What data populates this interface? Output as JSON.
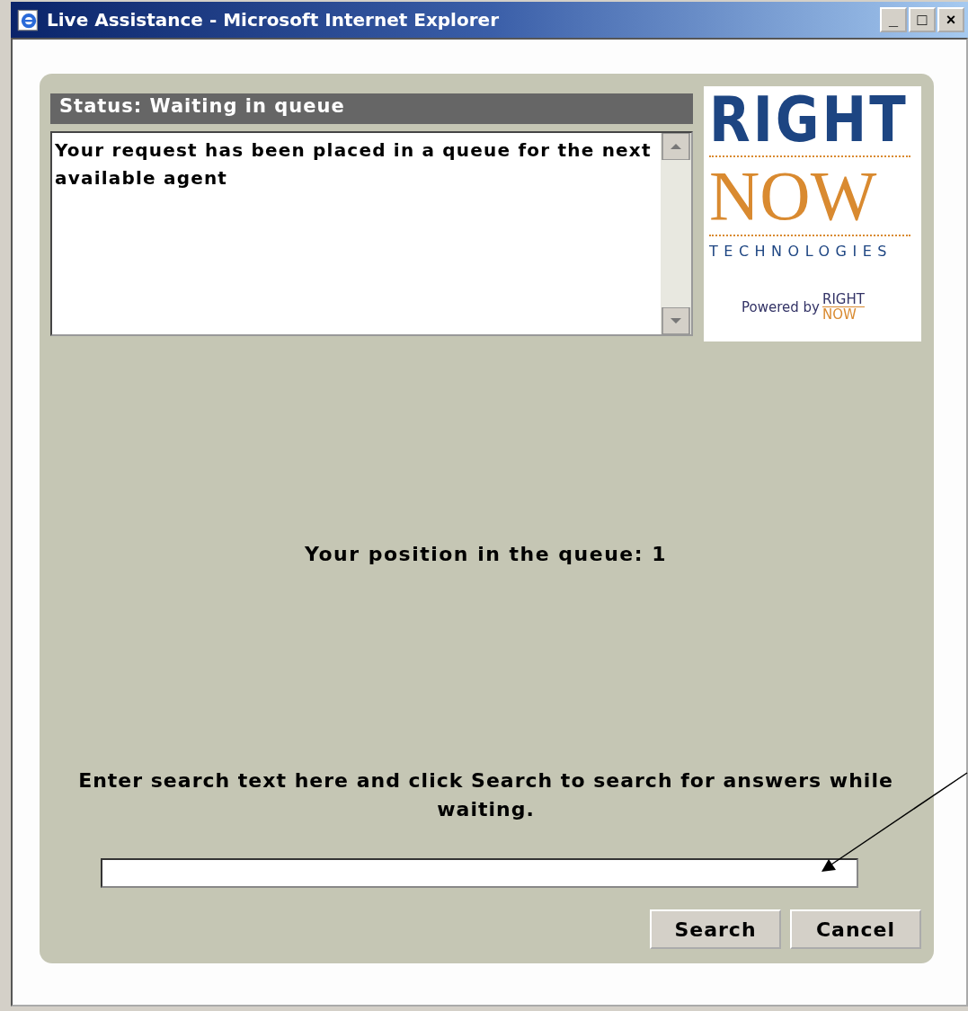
{
  "window": {
    "title": "Live Assistance - Microsoft Internet Explorer",
    "buttons": [
      "_",
      "□",
      "×"
    ]
  },
  "status": {
    "label": "Status: Waiting in queue"
  },
  "transcript": {
    "text": "Your request has been placed in a queue for the next available agent"
  },
  "logo": {
    "line_1": "RIGHT",
    "line_2": "NOW",
    "line_3": "TECHNOLOGIES",
    "powered_by": "Powered by",
    "small_line_1": "RIGHT",
    "small_line_2": "NOW"
  },
  "queue_position": "Your position in the queue: 1",
  "search_prompt": "Enter search text here and click Search to search for answers while waiting.",
  "buttons": [
    "Search",
    "Cancel"
  ]
}
